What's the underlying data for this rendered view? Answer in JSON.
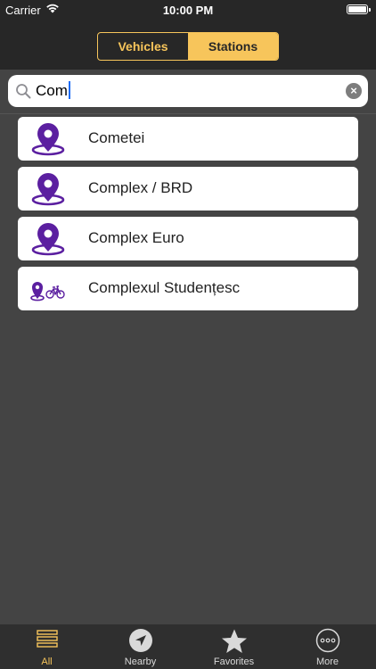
{
  "status_bar": {
    "carrier": "Carrier",
    "time": "10:00 PM"
  },
  "segmented_control": {
    "vehicles_label": "Vehicles",
    "stations_label": "Stations",
    "selected": "Stations"
  },
  "search": {
    "value": "Com",
    "clear_icon": "clear-icon",
    "search_icon": "search-icon"
  },
  "results": [
    {
      "name": "Cometei",
      "icon": "location-pin-icon"
    },
    {
      "name": "Complex / BRD",
      "icon": "location-pin-icon"
    },
    {
      "name": "Complex Euro",
      "icon": "location-pin-icon"
    },
    {
      "name": "Complexul Studențesc",
      "icon": "bike-station-icon"
    }
  ],
  "tab_bar": {
    "tabs": [
      {
        "label": "All",
        "icon": "list-icon",
        "active": true
      },
      {
        "label": "Nearby",
        "icon": "navigation-arrow-icon",
        "active": false
      },
      {
        "label": "Favorites",
        "icon": "star-icon",
        "active": false
      },
      {
        "label": "More",
        "icon": "more-icon",
        "active": false
      }
    ]
  },
  "colors": {
    "accent": "#f7c55b",
    "pin": "#5b1fa0",
    "background": "#444444",
    "bar": "#272727"
  }
}
